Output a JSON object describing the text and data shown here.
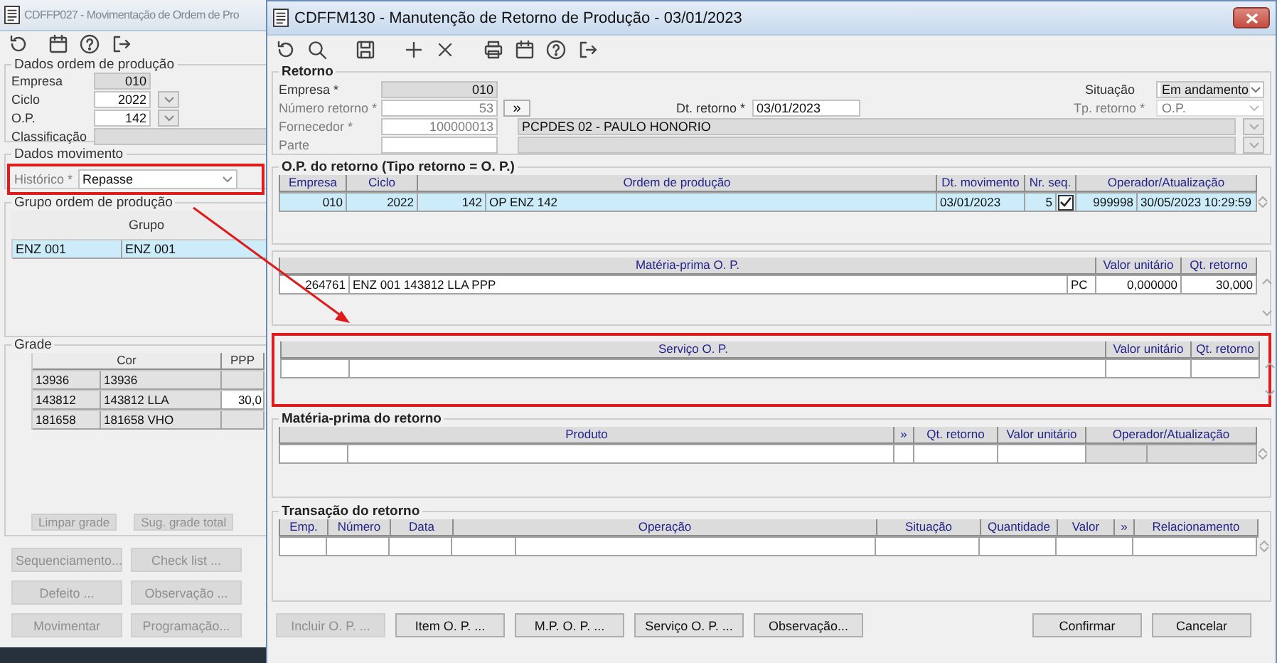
{
  "annotation_arrow": true,
  "back_window": {
    "title": "CDFFP027 - Movimentação de Ordem de Pro",
    "active": false,
    "toolbar": [
      [
        {
          "kind": "refresh"
        }
      ],
      [
        {
          "kind": "calendar"
        },
        {
          "kind": "help"
        },
        {
          "kind": "exit"
        }
      ]
    ],
    "ordem": {
      "legend": "Dados ordem de produção",
      "fields": [
        {
          "label": "Empresa",
          "value": "010",
          "kind": "readonly"
        },
        {
          "label": "Ciclo",
          "value": "2022",
          "kind": "lookup"
        },
        {
          "label": "O.P.",
          "value": "142",
          "kind": "lookup"
        },
        {
          "label": "Classificação",
          "kind": "readonly"
        }
      ]
    },
    "movimento": {
      "legend": "Dados movimento",
      "label": "Histórico *",
      "value": "Repasse",
      "highlighted": true
    },
    "grupo": {
      "legend": "Grupo ordem de produção",
      "columns": [
        {
          "label": "Grupo"
        }
      ],
      "rows": [
        {
          "selected": true,
          "cells": [
            [
              "ENZ 001",
              "ENZ 001"
            ]
          ]
        }
      ]
    },
    "grade": {
      "legend": "Grade",
      "columns": [
        {
          "label": "Cor"
        },
        {
          "label": "PPP"
        }
      ],
      "rows": [
        {
          "cells": [
            [
              "13936",
              "13936"
            ]
          ]
        },
        {
          "cells": [
            [
              "143812",
              "143812 LLA"
            ],
            "30,0"
          ]
        },
        {
          "cells": [
            [
              "181658",
              "181658 VHO"
            ]
          ]
        }
      ],
      "buttons": [
        "Limpar grade",
        "Sug. grade total"
      ]
    },
    "buttons": [
      {
        "label": "Sequenciamento...",
        "disabled": true
      },
      {
        "label": "Check list ...",
        "disabled": true
      },
      {
        "label": "Defeito ...",
        "disabled": true
      },
      {
        "label": "Observação ...",
        "disabled": true
      },
      {
        "label": "Movimentar",
        "disabled": true
      },
      {
        "label": "Programação...",
        "disabled": true
      }
    ]
  },
  "front_window": {
    "title": "CDFFM130 - Manutenção de Retorno de Produção - 03/01/2023",
    "active": true,
    "toolbar": [
      [
        {
          "kind": "refresh"
        },
        {
          "kind": "search"
        }
      ],
      [
        {
          "kind": "save"
        }
      ],
      [
        {
          "kind": "add"
        },
        {
          "kind": "delete"
        }
      ],
      [
        {
          "kind": "print"
        },
        {
          "kind": "calendar"
        },
        {
          "kind": "help"
        },
        {
          "kind": "exit"
        }
      ]
    ],
    "retorno": {
      "legend": "Retorno",
      "fields": [
        {
          "label": "Empresa *",
          "value": "010",
          "kind": "readonly",
          "disabled": false
        },
        {
          "label": "Número retorno *",
          "value": "53",
          "kind": "input",
          "disabled": true
        },
        {
          "label": "Fornecedor *",
          "value": "100000013",
          "kind": "input",
          "disabled": true
        },
        {
          "label": "Parte",
          "kind": "input",
          "disabled": true
        }
      ],
      "expand_button": "»",
      "fornecedor_name": "PCPDES 02 - PAULO HONORIO",
      "dt_retorno": {
        "label": "Dt. retorno *",
        "value": "03/01/2023"
      },
      "situacao": {
        "label": "Situação",
        "value": "Em andamento",
        "disabled": false
      },
      "tp_retorno": {
        "label": "Tp. retorno *",
        "value": "O.P.",
        "disabled": true
      }
    },
    "op_retorno": {
      "legend": "O.P. do retorno (Tipo retorno = O. P.)",
      "columns": [
        {
          "label": "Empresa"
        },
        {
          "label": "Ciclo"
        },
        {
          "label": "Ordem de produção"
        },
        {
          "label": "Dt. movimento"
        },
        {
          "label": "Nr. seq."
        },
        {
          "label": "Operador/Atualização"
        }
      ],
      "rows": [
        {
          "selected": true,
          "checked": true,
          "cells": [
            "010",
            "2022",
            [
              "142",
              "OP ENZ 142"
            ],
            "03/01/2023",
            "5",
            [
              "999998",
              "30/05/2023 10:29:59"
            ]
          ]
        }
      ]
    },
    "mp_op": {
      "columns": [
        {
          "label": "Matéria-prima O. P."
        },
        {
          "label": "Valor unitário"
        },
        {
          "label": "Qt. retorno"
        }
      ],
      "rows": [
        {
          "selected": false,
          "cells": [
            [
              "264761",
              "ENZ 001 143812 LLA PPP",
              "PC"
            ],
            "0,000000",
            "30,000"
          ]
        }
      ]
    },
    "servico_op": {
      "highlighted": true,
      "columns": [
        {
          "label": "Serviço O. P."
        },
        {
          "label": "Valor unitário"
        },
        {
          "label": "Qt. retorno"
        }
      ]
    },
    "mp_retorno": {
      "legend": "Matéria-prima do retorno",
      "columns": [
        {
          "label": "Produto"
        },
        {
          "label": "»"
        },
        {
          "label": "Qt. retorno"
        },
        {
          "label": "Valor unitário"
        },
        {
          "label": "Operador/Atualização"
        }
      ]
    },
    "transacao": {
      "legend": "Transação do retorno",
      "columns": [
        {
          "label": "Emp."
        },
        {
          "label": "Número"
        },
        {
          "label": "Data"
        },
        {
          "label": "Operação"
        },
        {
          "label": "Situação"
        },
        {
          "label": "Quantidade"
        },
        {
          "label": "Valor"
        },
        {
          "label": "»"
        },
        {
          "label": "Relacionamento"
        }
      ]
    },
    "buttons_left": [
      {
        "label": "Incluir O. P. ...",
        "disabled": true
      },
      {
        "label": "Item O. P. ...",
        "disabled": false
      },
      {
        "label": "M.P. O. P. ...",
        "disabled": false
      },
      {
        "label": "Serviço O. P. ...",
        "disabled": false
      },
      {
        "label": "Observação...",
        "disabled": false
      }
    ],
    "buttons_right": [
      {
        "label": "Confirmar",
        "disabled": false
      },
      {
        "label": "Cancelar",
        "disabled": false
      }
    ]
  }
}
